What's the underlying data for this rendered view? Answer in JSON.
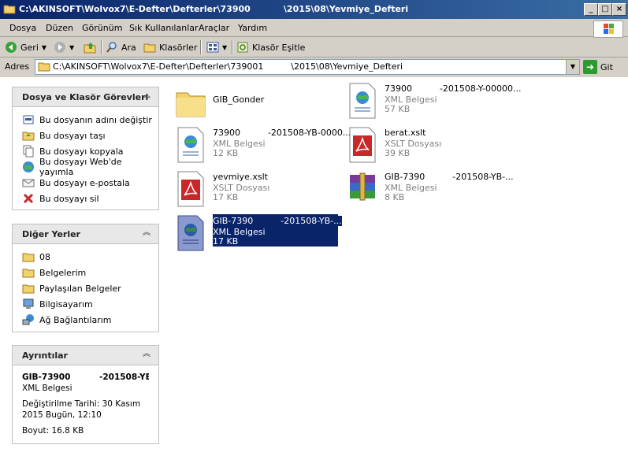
{
  "window": {
    "title": "C:\\AKINSOFT\\Wolvox7\\E-Defter\\Defterler\\73900           \\2015\\08\\Yevmiye_Defteri"
  },
  "menu": [
    "Dosya",
    "Düzen",
    "Görünüm",
    "Sık Kullanılanlar",
    "Araçlar",
    "Yardım"
  ],
  "toolbar": {
    "back_label": "Geri",
    "search_label": "Ara",
    "folders_label": "Klasörler",
    "sync_label": "Klasör Eşitle"
  },
  "address": {
    "label": "Adres",
    "path": "C:\\AKINSOFT\\Wolvox7\\E-Defter\\Defterler\\739001          \\2015\\08\\Yevmiye_Defteri",
    "go_label": "Git"
  },
  "tasks_panel": {
    "title": "Dosya ve Klasör Görevleri",
    "items": [
      {
        "label": "Bu dosyanın adını değiştir",
        "icon": "rename-icon"
      },
      {
        "label": "Bu dosyayı taşı",
        "icon": "move-icon"
      },
      {
        "label": "Bu dosyayı kopyala",
        "icon": "copy-icon"
      },
      {
        "label": "Bu dosyayı Web'de yayımla",
        "icon": "publish-icon"
      },
      {
        "label": "Bu dosyayı e-postala",
        "icon": "email-icon"
      },
      {
        "label": "Bu dosyayı sil",
        "icon": "delete-icon"
      }
    ]
  },
  "places_panel": {
    "title": "Diğer Yerler",
    "items": [
      {
        "label": "08",
        "icon": "folder-icon"
      },
      {
        "label": "Belgelerim",
        "icon": "folder-icon"
      },
      {
        "label": "Paylaşılan Belgeler",
        "icon": "folder-icon"
      },
      {
        "label": "Bilgisayarım",
        "icon": "computer-icon"
      },
      {
        "label": "Ağ Bağlantılarım",
        "icon": "network-icon"
      }
    ]
  },
  "details_panel": {
    "title": "Ayrıntılar",
    "name": "GIB-73900          -201508-YE",
    "type": "XML Belgesi",
    "modified_label": "Değiştirilme Tarihi: 30 Kasım",
    "modified_date": "2015 Bugün, 12:10",
    "size": "Boyut: 16.8 KB"
  },
  "files": [
    {
      "name": "GIB_Gonder",
      "type": "",
      "size": "",
      "icon": "folder-icon"
    },
    {
      "name": "73900          -201508-Y-00000...",
      "type": "XML Belgesi",
      "size": "57 KB",
      "icon": "xml-icon"
    },
    {
      "name": "73900          -201508-YB-0000...",
      "type": "XML Belgesi",
      "size": "12 KB",
      "icon": "xml-icon"
    },
    {
      "name": "berat.xslt",
      "type": "XSLT Dosyası",
      "size": "39 KB",
      "icon": "xslt-icon"
    },
    {
      "name": "yevmiye.xslt",
      "type": "XSLT Dosyası",
      "size": "17 KB",
      "icon": "xslt-icon"
    },
    {
      "name": "GIB-7390          -201508-YB-...",
      "type": "XML Belgesi",
      "size": "8 KB",
      "icon": "rar-icon"
    },
    {
      "name": "GIB-7390          -201508-YB-...",
      "type": "XML Belgesi",
      "size": "17 KB",
      "icon": "xml-icon",
      "selected": true
    }
  ]
}
